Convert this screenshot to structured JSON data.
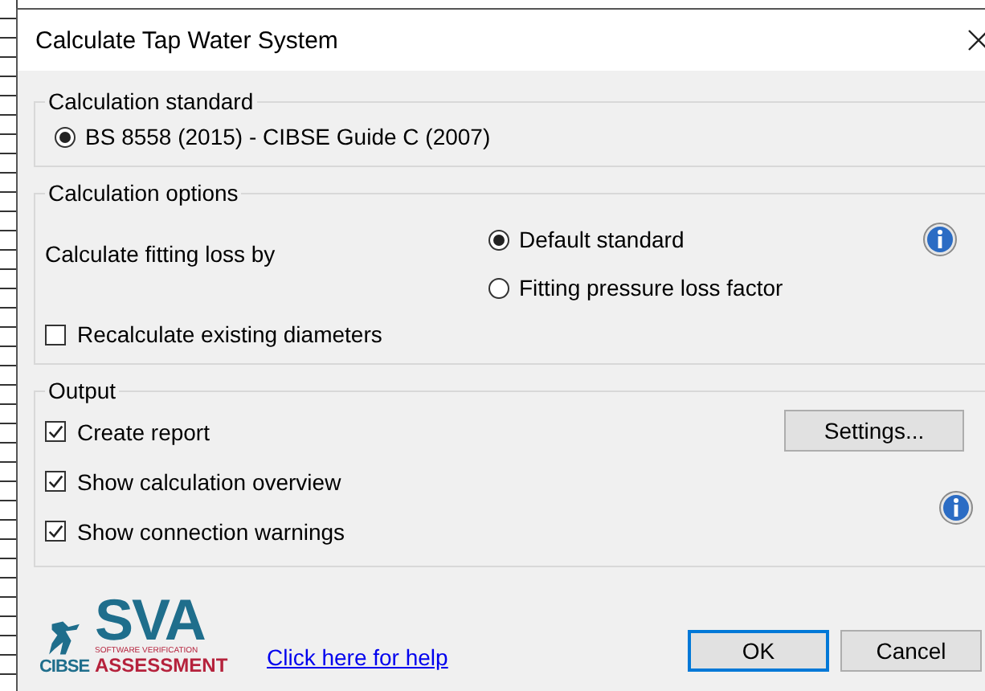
{
  "window": {
    "title": "Calculate Tap Water System"
  },
  "calculation_standard": {
    "title": "Calculation standard",
    "options": [
      {
        "label": "BS 8558 (2015) - CIBSE Guide C (2007)",
        "selected": true
      }
    ]
  },
  "calculation_options": {
    "title": "Calculation options",
    "fitting_loss_label": "Calculate fitting loss by",
    "fitting_loss_options": [
      {
        "label": "Default standard",
        "selected": true
      },
      {
        "label": "Fitting pressure loss factor",
        "selected": false
      }
    ],
    "recalculate": {
      "label": "Recalculate existing diameters",
      "checked": false
    }
  },
  "output": {
    "title": "Output",
    "checkboxes": [
      {
        "label": "Create report",
        "checked": true
      },
      {
        "label": "Show calculation overview",
        "checked": true
      },
      {
        "label": "Show connection warnings",
        "checked": true
      }
    ],
    "settings_button": "Settings..."
  },
  "logo": {
    "left": "CIBSE",
    "main": "SVA",
    "tagline": "SOFTWARE VERIFICATION",
    "bottom": "ASSESSMENT"
  },
  "help_link": "Click here for help",
  "buttons": [
    {
      "label": "OK",
      "kind": "default"
    },
    {
      "label": "Cancel",
      "kind": "normal"
    }
  ]
}
